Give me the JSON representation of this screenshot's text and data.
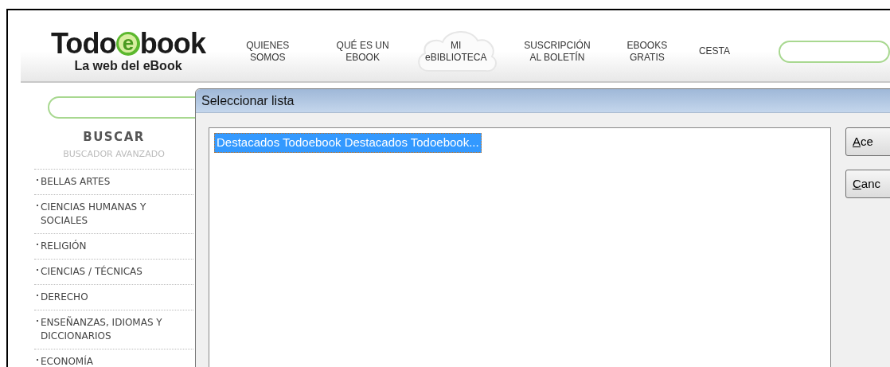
{
  "header": {
    "logo": {
      "prefix": "Todo",
      "badge_letter": "e",
      "suffix": "book",
      "tagline": "La web del eBook"
    },
    "nav": [
      {
        "label": "QUIENES SOMOS",
        "kind": "plain"
      },
      {
        "label": "QUÉ ES UN EBOOK",
        "kind": "plain"
      },
      {
        "label": "MI eBIBLIOTECA",
        "kind": "cloud"
      },
      {
        "label": "SUSCRIPCIÓN AL BOLETÍN",
        "kind": "plain"
      },
      {
        "label": "EBOOKS GRATIS",
        "kind": "plain"
      },
      {
        "label": "CESTA",
        "kind": "plain"
      }
    ]
  },
  "sidebar": {
    "title": "BUSCAR",
    "advanced_link": "BUSCADOR AVANZADO",
    "categories": [
      "BELLAS ARTES",
      "CIENCIAS HUMANAS Y SOCIALES",
      "RELIGIÓN",
      "CIENCIAS / TÉCNICAS",
      "DERECHO",
      "ENSEÑANZAS, IDIOMAS Y DICCIONARIOS",
      "ECONOMÍA"
    ]
  },
  "dialog": {
    "title": "Seleccionar lista",
    "items": [
      {
        "label": "Destacados Todoebook Destacados Todoebook...",
        "selected": true
      }
    ],
    "buttons": [
      "Ace",
      "Canc"
    ]
  }
}
